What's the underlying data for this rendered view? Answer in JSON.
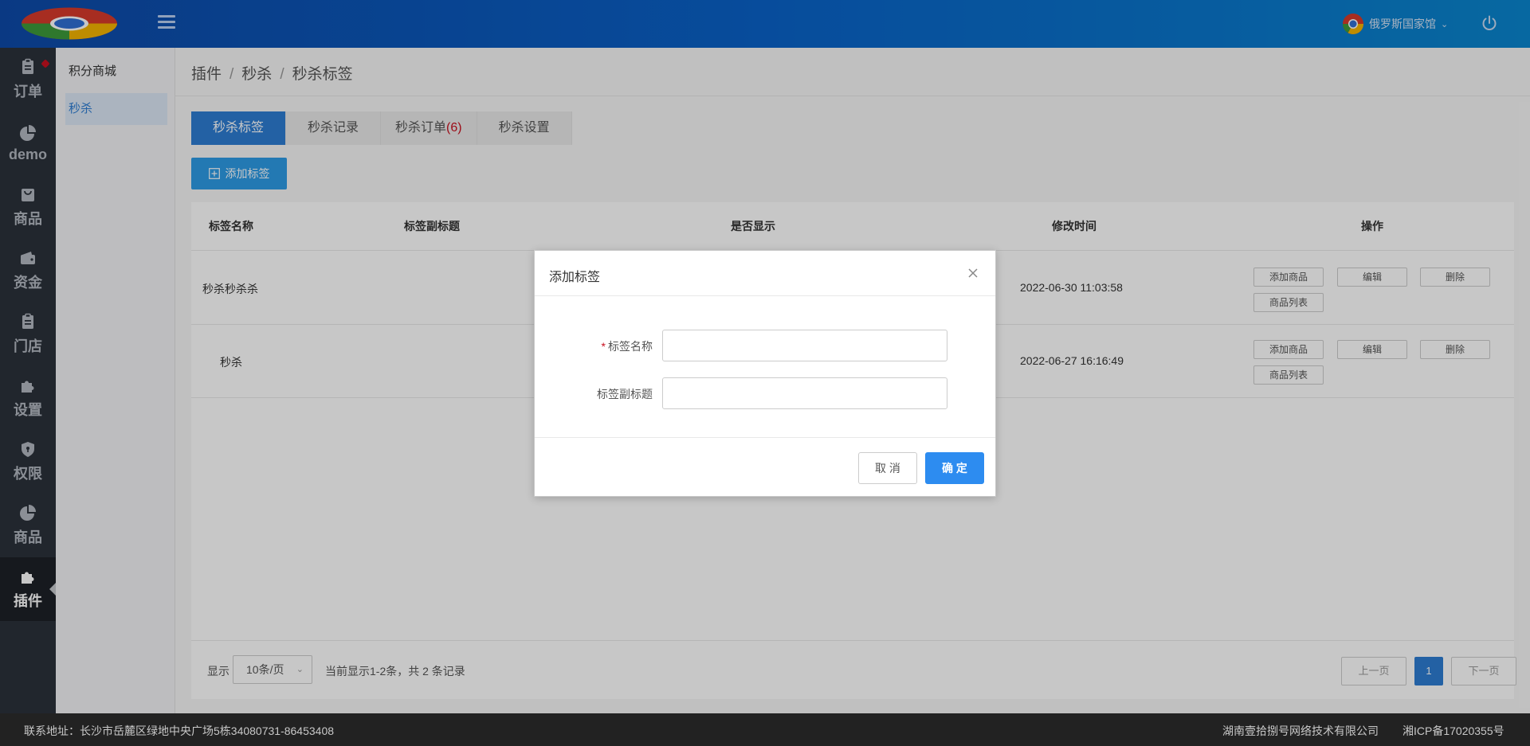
{
  "header": {
    "user_name": "俄罗斯国家馆"
  },
  "leftnav": {
    "items": [
      {
        "label": "订单",
        "icon": "clipboard-icon"
      },
      {
        "label": "demo",
        "icon": "pie-chart-icon"
      },
      {
        "label": "商品",
        "icon": "bag-icon"
      },
      {
        "label": "资金",
        "icon": "wallet-icon"
      },
      {
        "label": "门店",
        "icon": "clipboard-icon"
      },
      {
        "label": "设置",
        "icon": "puzzle-icon"
      },
      {
        "label": "权限",
        "icon": "shield-icon"
      },
      {
        "label": "商品",
        "icon": "pie-chart-icon"
      },
      {
        "label": "插件",
        "icon": "puzzle-icon"
      }
    ]
  },
  "subnav": {
    "items": [
      {
        "label": "积分商城"
      },
      {
        "label": "秒杀"
      }
    ]
  },
  "breadcrumb": [
    "插件",
    "秒杀",
    "秒杀标签"
  ],
  "breadcrumb_sep": "/",
  "tabs": [
    {
      "label": "秒杀标签"
    },
    {
      "label": "秒杀记录"
    },
    {
      "label": "秒杀订单",
      "count": "(6)"
    },
    {
      "label": "秒杀设置"
    }
  ],
  "add_button": "添加标签",
  "table": {
    "columns": [
      "标签名称",
      "标签副标题",
      "是否显示",
      "修改时间",
      "操作"
    ],
    "rows": [
      {
        "name": "秒杀秒杀杀",
        "subtitle": "",
        "time": "2022-06-30 11:03:58"
      },
      {
        "name": "秒杀",
        "subtitle": "",
        "time": "2022-06-27 16:16:49"
      }
    ],
    "actions": {
      "add_goods": "添加商品",
      "edit": "编辑",
      "delete": "删除",
      "goods_list": "商品列表"
    }
  },
  "pager": {
    "show_label": "显示",
    "page_size": "10条/页",
    "summary": "当前显示1-2条，共 2 条记录",
    "prev": "上一页",
    "current": "1",
    "next": "下一页"
  },
  "footer": {
    "address": "联系地址：长沙市岳麓区绿地中央广场5栋34080731-86453408",
    "company": "湖南壹拾捌号网络技术有限公司",
    "icp": "湘ICP备17020355号"
  },
  "modal": {
    "title": "添加标签",
    "required_mark": "*",
    "name_label": "标签名称",
    "name_value": "",
    "subtitle_label": "标签副标题",
    "subtitle_value": "",
    "cancel": "取 消",
    "ok": "确 定"
  },
  "colors": {
    "primary": "#2d7dd2",
    "confirm": "#2d8cf0",
    "danger": "#c8101f",
    "nav_bg": "#2b313a"
  }
}
